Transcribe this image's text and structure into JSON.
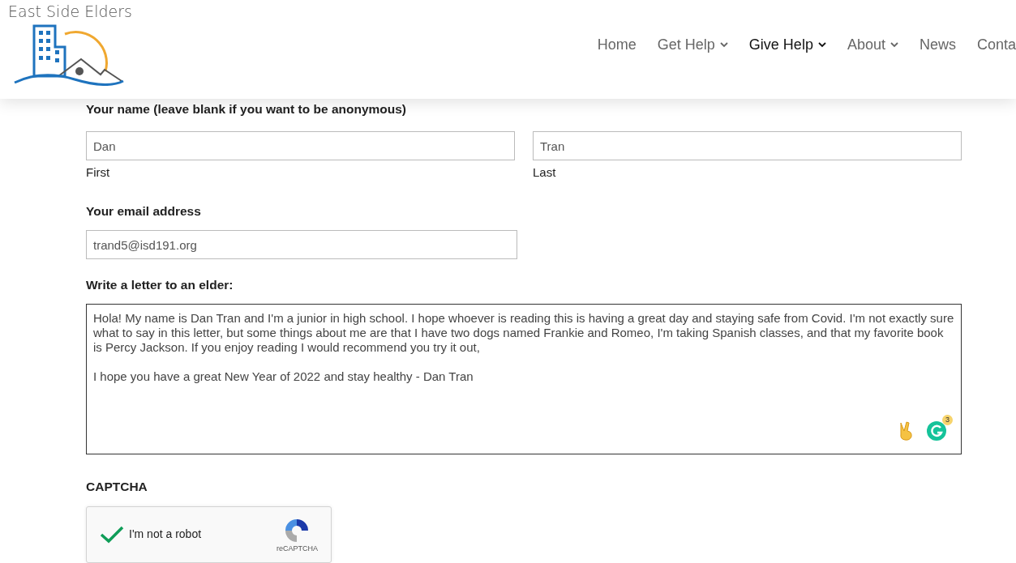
{
  "logo": {
    "text": "East Side Elders"
  },
  "nav": [
    {
      "label": "Home",
      "dropdown": false,
      "selected": false
    },
    {
      "label": "Get Help",
      "dropdown": true,
      "selected": false
    },
    {
      "label": "Give Help",
      "dropdown": true,
      "selected": true
    },
    {
      "label": "About",
      "dropdown": true,
      "selected": false
    },
    {
      "label": "News",
      "dropdown": false,
      "selected": false
    },
    {
      "label": "Conta",
      "dropdown": false,
      "selected": false
    }
  ],
  "name_section": {
    "label": "Your name (leave blank if you want to be anonymous)",
    "first": {
      "value": "Dan",
      "sublabel": "First"
    },
    "last": {
      "value": "Tran",
      "sublabel": "Last"
    }
  },
  "email": {
    "label": "Your email address",
    "value": "trand5@isd191.org"
  },
  "letter": {
    "label": "Write a letter to an elder:",
    "paragraphs": [
      "Hola! My name is Dan Tran and I'm a junior in high school. I hope whoever is reading this is having a great day and staying safe from Covid. I'm not exactly sure what to say in this letter, but some things about me are that I have two dogs named Frankie and Romeo, I'm taking Spanish classes, and that my favorite book is Percy Jackson. If you enjoy reading I would recommend you try it out,",
      "I hope you have a great New Year of 2022 and stay healthy - Dan Tran"
    ],
    "grammar_count": "3"
  },
  "captcha": {
    "label": "CAPTCHA",
    "checkbox_label": "I'm not a robot",
    "checked": true,
    "brand": "reCAPTCHA"
  }
}
